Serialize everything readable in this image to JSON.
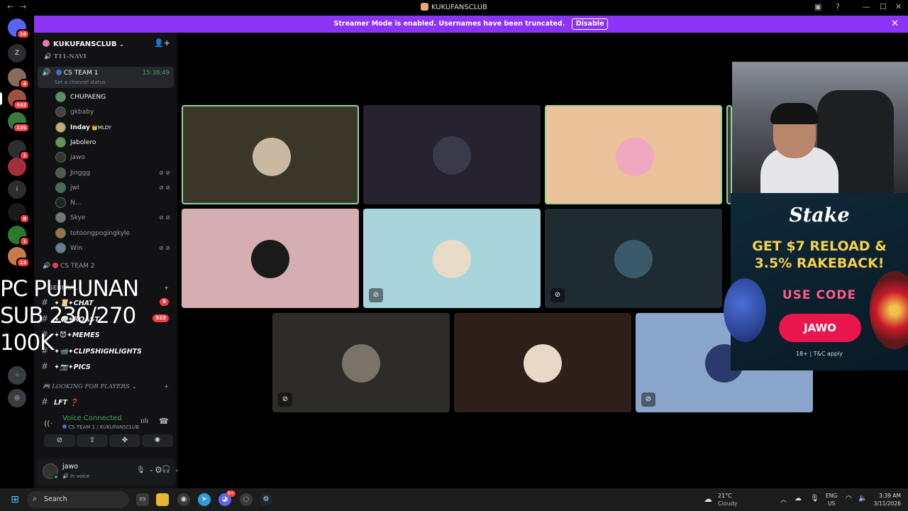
{
  "window": {
    "title": "KUKUFANSCLUB"
  },
  "banner": {
    "text": "Streamer Mode is enabled. Usernames have been truncated.",
    "button": "Disable"
  },
  "guilds": [
    {
      "label": "",
      "badge": "18"
    },
    {
      "label": "Z",
      "badge": ""
    },
    {
      "label": "",
      "badge": "4"
    },
    {
      "label": "",
      "badge": "532"
    },
    {
      "label": "",
      "badge": "135"
    },
    {
      "label": "",
      "badge": "1"
    },
    {
      "label": "",
      "badge": ""
    },
    {
      "label": "i",
      "badge": ""
    },
    {
      "label": "",
      "badge": "8"
    },
    {
      "label": "",
      "badge": "1"
    },
    {
      "label": "",
      "badge": "13"
    }
  ],
  "server": {
    "name": "KUKUFANSCLUB"
  },
  "sidebar": {
    "top_channel": "T11-NAVI",
    "voice_channel": {
      "name": "CS TEAM 1",
      "timer": "15:38:49",
      "status": "Set a channel status"
    },
    "members": [
      {
        "name": "CHUPAENG",
        "muted": false,
        "color": "#5a8f6b"
      },
      {
        "name": "gkbaby",
        "muted": false,
        "color": "#444"
      },
      {
        "name": "Inday",
        "tag": "MLDY",
        "muted": false,
        "color": "#c9a97a"
      },
      {
        "name": "Jabolero",
        "muted": false,
        "color": "#6b8f5a"
      },
      {
        "name": "jawo",
        "muted": false,
        "color": "#333"
      },
      {
        "name": "Jinggg",
        "muted": true,
        "color": "#555"
      },
      {
        "name": "jwl",
        "muted": true,
        "color": "#4a6a5a"
      },
      {
        "name": "N...",
        "muted": false,
        "color": "#222"
      },
      {
        "name": "Skye",
        "muted": true,
        "color": "#777"
      },
      {
        "name": "totoongpogingkyle",
        "muted": false,
        "color": "#a0704a"
      },
      {
        "name": "Win",
        "muted": true,
        "color": "#6a7a9a"
      }
    ],
    "voice_channel_2": "CS TEAM 2",
    "category_1": "GENERAL",
    "text_channels": [
      {
        "name": "✦📜✦CHAT",
        "badge": "9"
      },
      {
        "name": "✦💬✦ROAST",
        "badge": "522"
      },
      {
        "name": "✦😈✦MEMES",
        "badge": ""
      },
      {
        "name": "✦📹✦CLIPSHIGHLIGHTS",
        "badge": ""
      },
      {
        "name": "✦📷✦PICS",
        "badge": ""
      }
    ],
    "category_2": "🎮 LOOKING FOR PLAYERS",
    "lft_channel": "LFT ❓"
  },
  "voice_panel": {
    "status": "Voice Connected",
    "location": "CS TEAM 1 / KUKUFANSCLUB"
  },
  "user_panel": {
    "name": "jawo",
    "status": "In voice"
  },
  "overlay": {
    "line1": "PC PUHUNAN",
    "line2": "SUB 230/270",
    "line3": "100K"
  },
  "tiles": [
    {
      "bg": "#3a3628",
      "speaking": true,
      "muted": false,
      "face": "#c9b9a0"
    },
    {
      "bg": "#26222f",
      "speaking": false,
      "muted": false,
      "face": "#3a3a4a"
    },
    {
      "bg": "#ecc29a",
      "speaking": true,
      "muted": false,
      "face": "#f0a8c0"
    },
    {
      "bg": "#d4aeb0",
      "speaking": false,
      "muted": false,
      "face": "#1a1a1a"
    },
    {
      "bg": "#a8d4dc",
      "speaking": false,
      "muted": true,
      "face": "#e8dcc8"
    },
    {
      "bg": "#1e2b30",
      "speaking": false,
      "muted": true,
      "face": "#3a5a6a"
    },
    {
      "bg": "#2e2c28",
      "speaking": false,
      "muted": true,
      "face": "#7a7468"
    },
    {
      "bg": "#2e2018",
      "speaking": false,
      "muted": false,
      "face": "#e8d8c8"
    },
    {
      "bg": "#8aa6cc",
      "speaking": false,
      "muted": true,
      "face": "#2a3a6a"
    }
  ],
  "ad": {
    "brand": "Stake",
    "headline1": "GET $7 RELOAD &",
    "headline2": "3.5% RAKEBACK!",
    "use_code": "USE CODE",
    "code": "JAWO",
    "fine": "18+ | T&C apply"
  },
  "taskbar": {
    "search": "Search",
    "weather_temp": "21°C",
    "weather_desc": "Cloudy",
    "lang1": "ENG",
    "lang2": "US",
    "time": "3:39 AM",
    "date": "3/11/2026",
    "discord_badge": "9+"
  }
}
